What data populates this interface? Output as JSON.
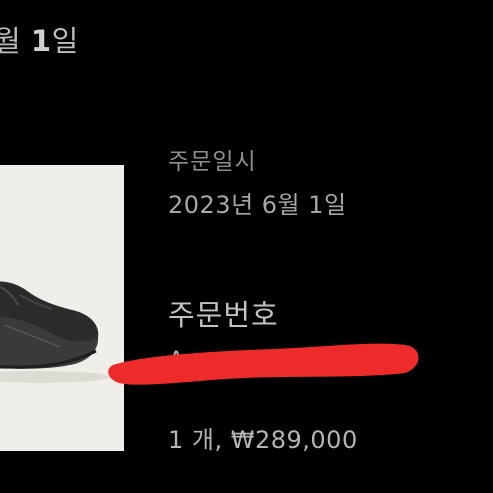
{
  "header": {
    "date_month_text": "월",
    "date_day_number": "1",
    "date_day_text": "일"
  },
  "product": {
    "image_icon": "sneaker-image"
  },
  "order": {
    "date_label": "주문일시",
    "date_value": "2023년 6월 1일",
    "number_label": "주문번호",
    "number_value_visible": "A",
    "redaction_color": "#ee2b2b",
    "quantity_price": "1 개, ₩289,000"
  },
  "colors": {
    "background": "#000000",
    "image_background": "#efeee8",
    "text_primary": "#c2c2c2",
    "text_secondary": "#8e8e8e"
  }
}
